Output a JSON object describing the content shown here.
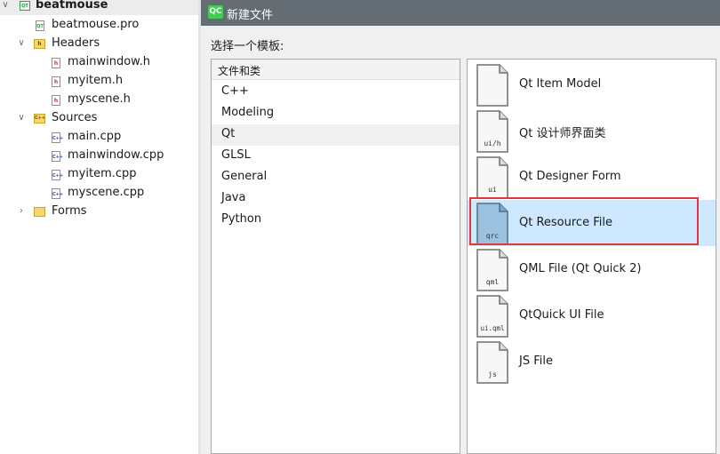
{
  "project_tree": {
    "root": "beatmouse",
    "pro_file": "beatmouse.pro",
    "headers_label": "Headers",
    "headers": [
      "mainwindow.h",
      "myitem.h",
      "myscene.h"
    ],
    "sources_label": "Sources",
    "sources": [
      "main.cpp",
      "mainwindow.cpp",
      "myitem.cpp",
      "myscene.cpp"
    ],
    "forms_label": "Forms",
    "h_icon": "h",
    "cpp_icon": "C++",
    "qt_icon": "QT",
    "folder_h": "h",
    "folder_cpp": "C++"
  },
  "dialog": {
    "logo": "QC",
    "title": "新建文件",
    "choose_template": "选择一个模板:",
    "category_header": "文件和类",
    "categories": [
      "C++",
      "Modeling",
      "Qt",
      "GLSL",
      "General",
      "Java",
      "Python"
    ],
    "selected_category": "Qt",
    "templates": [
      {
        "label": "Qt Item Model",
        "icon_text": ""
      },
      {
        "label": "Qt 设计师界面类",
        "icon_text": "ui/h"
      },
      {
        "label": "Qt Designer Form",
        "icon_text": "ui"
      },
      {
        "label": "Qt Resource File",
        "icon_text": "qrc"
      },
      {
        "label": "QML File (Qt Quick 2)",
        "icon_text": "qml"
      },
      {
        "label": "QtQuick UI File",
        "icon_text": "ui.qml"
      },
      {
        "label": "JS File",
        "icon_text": "js"
      }
    ],
    "selected_template": "Qt Resource File"
  },
  "colors": {
    "titlebar": "#646d73",
    "selection": "#cde8ff",
    "highlight_box": "#e0363c",
    "qt_green": "#41cd52"
  }
}
